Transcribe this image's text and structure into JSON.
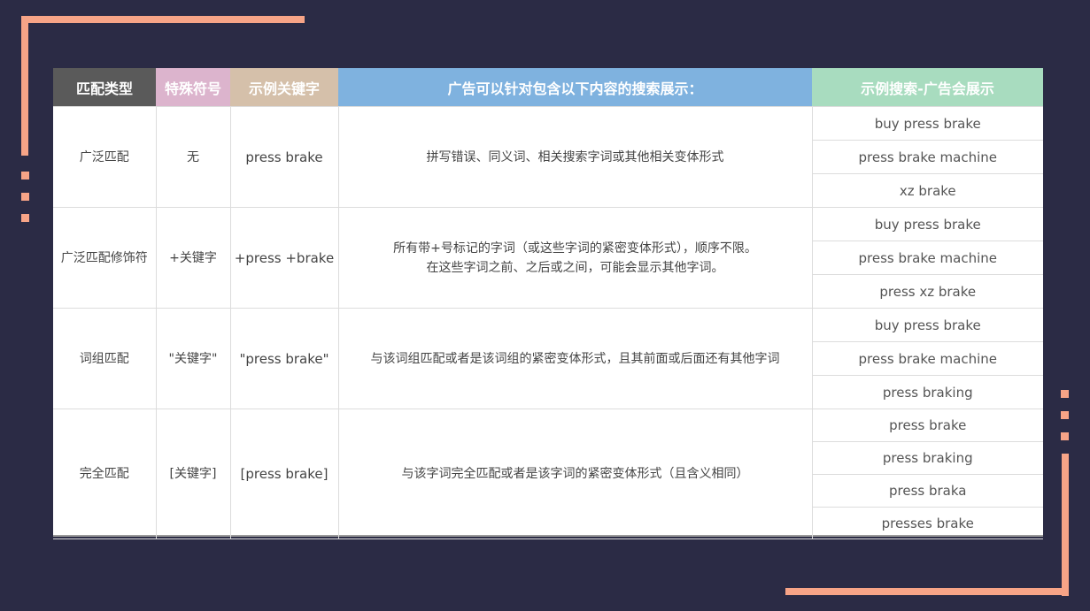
{
  "header": {
    "col1": "匹配类型",
    "col2": "特殊符号",
    "col3": "示例关键字",
    "col4": "广告可以针对包含以下内容的搜索展示：",
    "col5": "示例搜索-广告会展示"
  },
  "colors": {
    "col1": "#5a5a5a",
    "col2": "#dcb4cd",
    "col3": "#d5c0aa",
    "col4": "#7fb2df",
    "col5": "#a8dcbf",
    "accent": "#f7a487",
    "background": "#2b2b45"
  },
  "rows": [
    {
      "type": "广泛匹配",
      "symbol": "无",
      "keyword": "press brake",
      "desc": [
        "拼写错误、同义词、相关搜索字词或其他相关变体形式"
      ],
      "examples": [
        "buy press brake",
        "press brake machine",
        "xz brake"
      ]
    },
    {
      "type": "广泛匹配修饰符",
      "symbol": "+关键字",
      "keyword": "+press +brake",
      "desc": [
        "所有带+号标记的字词（或这些字词的紧密变体形式），顺序不限。",
        "在这些字词之前、之后或之间，可能会显示其他字词。"
      ],
      "examples": [
        "buy press brake",
        "press brake machine",
        "press xz brake"
      ]
    },
    {
      "type": "词组匹配",
      "symbol": "\"关键字\"",
      "keyword": "\"press brake\"",
      "desc": [
        "与该词组匹配或者是该词组的紧密变体形式，且其前面或后面还有其他字词"
      ],
      "examples": [
        "buy press brake",
        "press brake machine",
        "press braking"
      ]
    },
    {
      "type": "完全匹配",
      "symbol": "[关键字]",
      "keyword": "[press brake]",
      "desc": [
        "与该字词完全匹配或者是该字词的紧密变体形式（且含义相同）"
      ],
      "examples": [
        "press brake",
        "press braking",
        "press braka",
        "presses brake"
      ]
    }
  ]
}
